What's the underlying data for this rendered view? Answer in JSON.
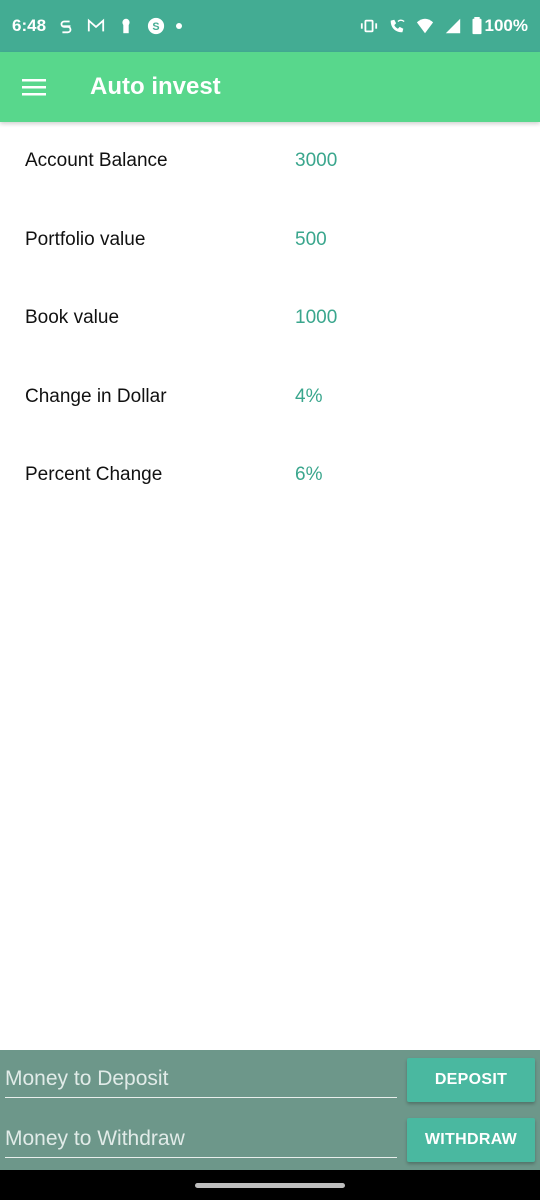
{
  "status_bar": {
    "time": "6:48",
    "battery": "100%",
    "left_icons": [
      "s-app-icon",
      "gmail-icon",
      "keyhole-icon",
      "s-circle-icon",
      "dot-icon"
    ],
    "right_icons": [
      "vibrate-icon",
      "wifi-call-icon",
      "wifi-icon",
      "signal-icon",
      "battery-icon"
    ]
  },
  "app_bar": {
    "title": "Auto invest",
    "menu_icon": "hamburger-menu-icon",
    "color": "#58d78c"
  },
  "account": {
    "rows": [
      {
        "label": "Account Balance",
        "value": "3000"
      },
      {
        "label": "Portfolio value",
        "value": "500"
      },
      {
        "label": "Book value",
        "value": "1000"
      },
      {
        "label": "Change in Dollar",
        "value": "4%"
      },
      {
        "label": "Percent Change",
        "value": "6%"
      }
    ]
  },
  "bottom": {
    "deposit_placeholder": "Money to Deposit",
    "deposit_button": "DEPOSIT",
    "withdraw_placeholder": "Money to Withdraw",
    "withdraw_button": "WITHDRAW"
  },
  "colors": {
    "status_bar": "#43ac93",
    "value_text": "#3aa68d",
    "bottom_panel": "#6d978a",
    "button": "#4ab8a0"
  }
}
